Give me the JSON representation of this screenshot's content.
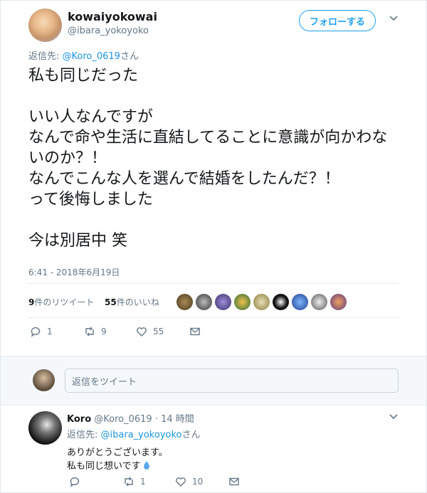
{
  "main_tweet": {
    "display_name": "kowaiyokowai",
    "handle": "@ibara_yokoyoko",
    "follow_label": "フォローする",
    "reply_prefix": "返信先: ",
    "reply_target": "@Koro_0619",
    "reply_suffix": "さん",
    "text": "私も同じだった\n\nいい人なんですが\nなんで命や生活に直結してることに意識が向かわないのか？！\nなんでこんな人を選んで結婚をしたんだ？！\nって後悔しました\n\n今は別居中 笑",
    "timestamp": "6:41 - 2018年6月19日",
    "retweet_count": "9",
    "retweet_label": "件のリツイート",
    "like_count": "55",
    "like_label": "件のいいね",
    "actions": {
      "reply": "1",
      "retweet": "9",
      "like": "55"
    }
  },
  "reply_input": {
    "placeholder": "返信をツイート"
  },
  "reply_tweet": {
    "display_name": "Koro",
    "handle": "@Koro_0619",
    "separator": "·",
    "time": "14 時間",
    "reply_prefix": "返信先: ",
    "reply_target": "@ibara_yokoyoko",
    "reply_suffix": "さん",
    "line1": "ありがとうございます。",
    "line2": "私も同じ想いです",
    "actions": {
      "reply": "",
      "retweet": "1",
      "like": "10"
    }
  },
  "colors": {
    "accent": "#1da1f2",
    "link": "#1b95e0",
    "muted": "#657786",
    "text": "#14171a"
  },
  "icons": [
    "chevron-down-icon",
    "reply-icon",
    "retweet-icon",
    "like-icon",
    "message-icon",
    "droplet-icon"
  ]
}
